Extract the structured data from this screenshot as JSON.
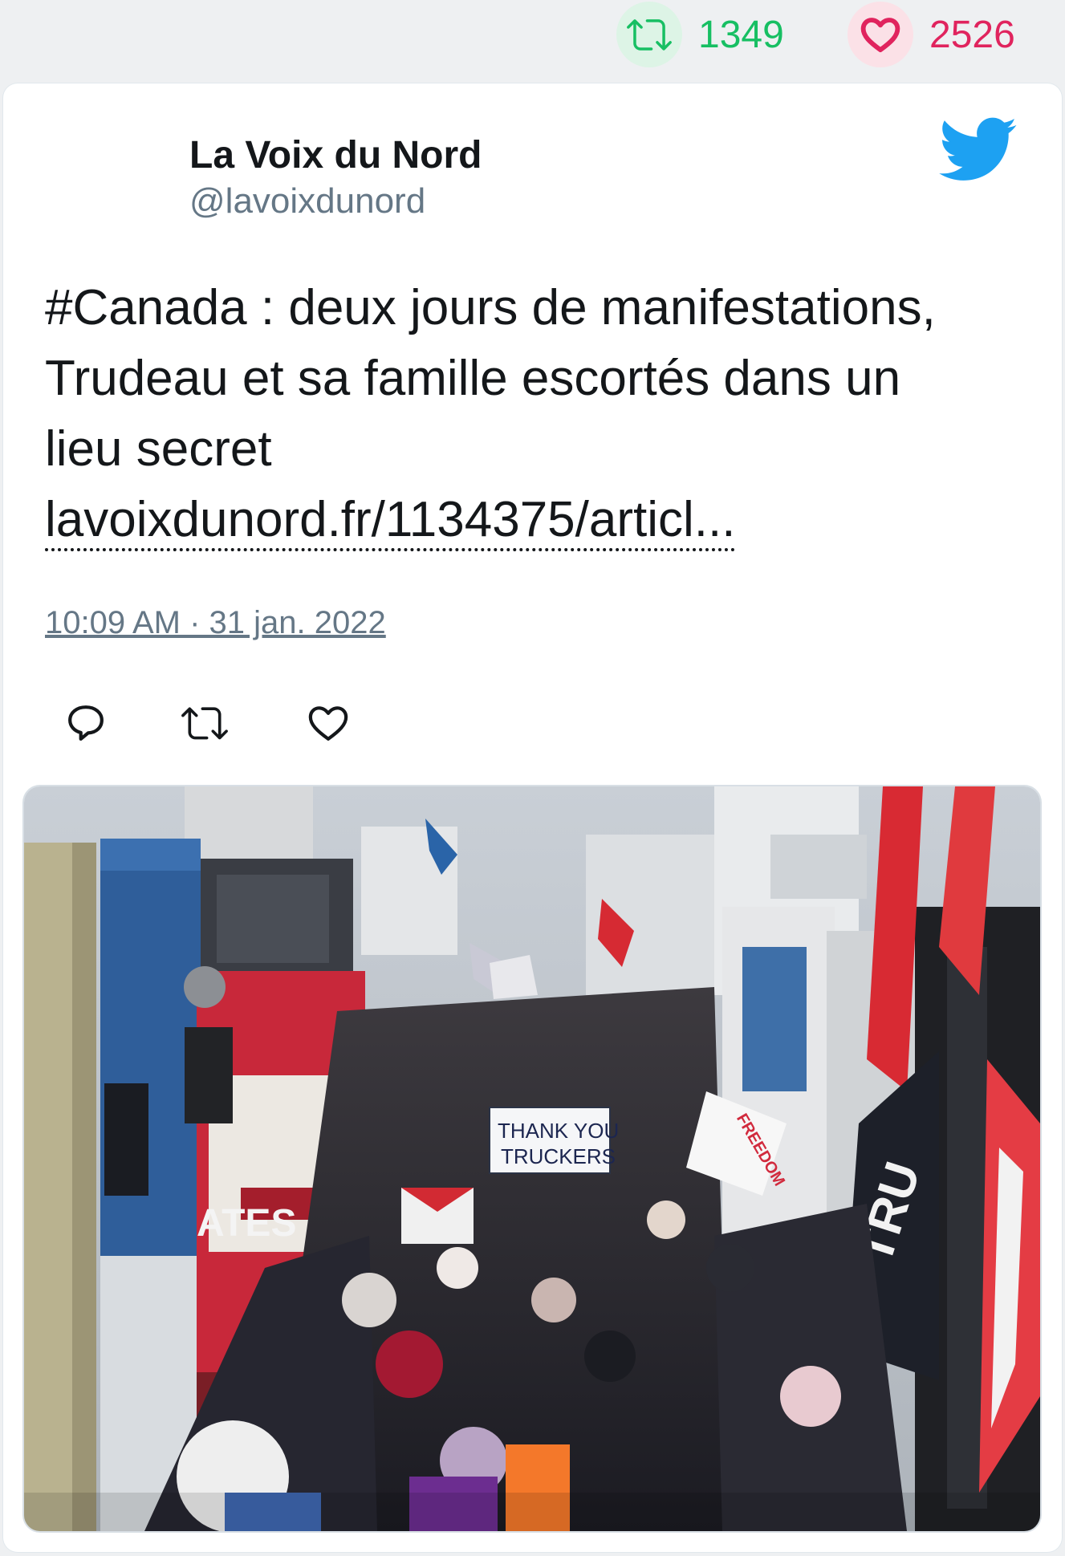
{
  "stats": {
    "retweets": "1349",
    "likes": "2526"
  },
  "tweet": {
    "author_name": "La Voix du Nord",
    "author_handle": "@lavoixdunord",
    "text_lines": [
      "#Canada : deux jours de manifestations,",
      "Trudeau et sa famille escortés dans un",
      "lieu secret"
    ],
    "link_text": "lavoixdunord.fr/1134375/articl...",
    "timestamp": "10:09 AM · 31 jan. 2022"
  },
  "media": {
    "sign_line1": "THANK YOU",
    "sign_line2": "TRUCKERS",
    "sign_right": "FREEDOM",
    "truck_text": "ATES",
    "flag_text": "TRU"
  },
  "icons": {
    "retweet_stat": "retweet-icon",
    "like_stat": "heart-icon",
    "brand": "twitter-bird-icon",
    "reply": "reply-icon",
    "retweet": "retweet-icon",
    "like": "like-icon"
  },
  "colors": {
    "retweet_green": "#17bf63",
    "like_red": "#e0245e",
    "twitter_blue": "#1da1f2",
    "muted_text": "#657786"
  }
}
